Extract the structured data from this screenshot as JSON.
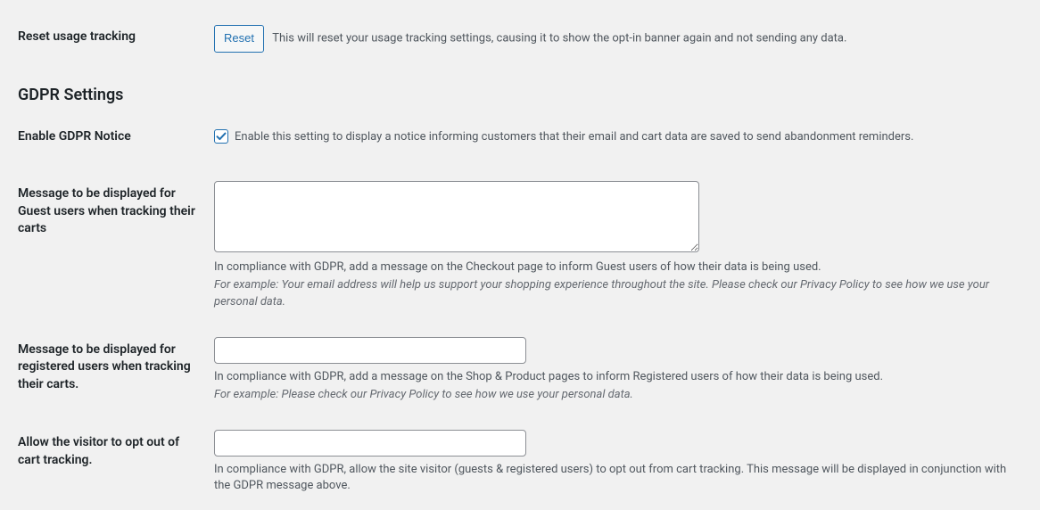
{
  "reset": {
    "label": "Reset usage tracking",
    "button": "Reset",
    "desc": "This will reset your usage tracking settings, causing it to show the opt-in banner again and not sending any data."
  },
  "section_title": "GDPR Settings",
  "enable": {
    "label": "Enable GDPR Notice",
    "checked": true,
    "desc": "Enable this setting to display a notice informing customers that their email and cart data are saved to send abandonment reminders."
  },
  "guest_msg": {
    "label": "Message to be displayed for Guest users when tracking their carts",
    "value": "",
    "desc": "In compliance with GDPR, add a message on the Checkout page to inform Guest users of how their data is being used.",
    "example": "For example: Your email address will help us support your shopping experience throughout the site. Please check our Privacy Policy to see how we use your personal data."
  },
  "registered_msg": {
    "label": "Message to be displayed for registered users when tracking their carts.",
    "value": "",
    "desc": "In compliance with GDPR, add a message on the Shop & Product pages to inform Registered users of how their data is being used.",
    "example": "For example: Please check our Privacy Policy to see how we use your personal data."
  },
  "optout": {
    "label": "Allow the visitor to opt out of cart tracking.",
    "value": "",
    "desc": "In compliance with GDPR, allow the site visitor (guests & registered users) to opt out from cart tracking. This message will be displayed in conjunction with the GDPR message above."
  }
}
